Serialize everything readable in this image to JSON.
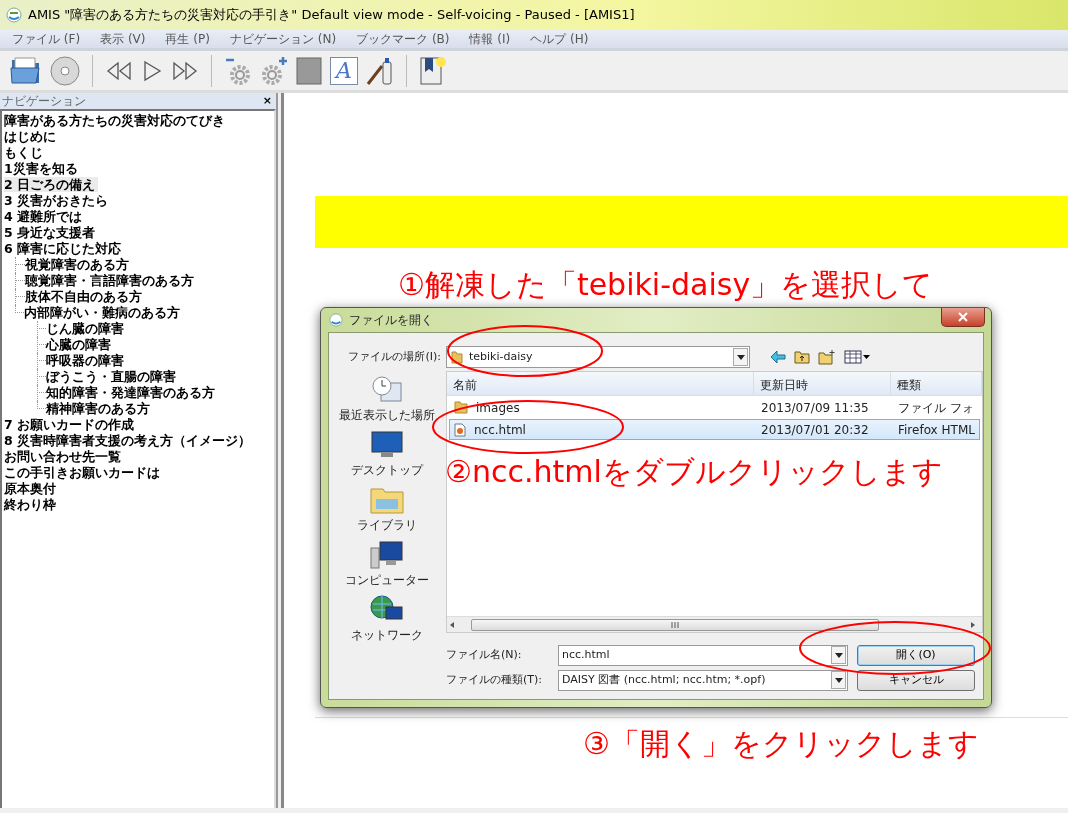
{
  "window": {
    "title": "AMIS \"障害のある方たちの災害対応の手引き\" Default view mode - Self-voicing - Paused - [AMIS1]"
  },
  "menu": [
    {
      "label": "ファイル (F)"
    },
    {
      "label": "表示 (V)"
    },
    {
      "label": "再生 (P)"
    },
    {
      "label": "ナビゲーション (N)"
    },
    {
      "label": "ブックマーク (B)"
    },
    {
      "label": "情報 (I)"
    },
    {
      "label": "ヘルプ (H)"
    }
  ],
  "toolbar": {
    "font_label": "A"
  },
  "navigation": {
    "title": "ナビゲーション",
    "close": "×",
    "items": [
      {
        "label": "障害がある方たちの災害対応のてびき",
        "selected": false
      },
      {
        "label": "はじめに",
        "selected": false
      },
      {
        "label": "もくじ",
        "selected": false
      },
      {
        "label": "1災害を知る",
        "selected": false
      },
      {
        "label": "2 日ごろの備え",
        "selected": true
      },
      {
        "label": "3 災害がおきたら",
        "selected": false
      },
      {
        "label": "4 避難所では",
        "selected": false
      },
      {
        "label": "5 身近な支援者",
        "selected": false
      },
      {
        "label": "6 障害に応じた対応",
        "selected": false,
        "children": [
          {
            "label": "視覚障害のある方",
            "selected": false
          },
          {
            "label": "聴覚障害・言語障害のある方",
            "selected": false
          },
          {
            "label": "肢体不自由のある方",
            "selected": false
          },
          {
            "label": "内部障がい・難病のある方",
            "selected": false,
            "children": [
              {
                "label": "じん臓の障害",
                "selected": false
              },
              {
                "label": "心臓の障害",
                "selected": false
              },
              {
                "label": "呼吸器の障害",
                "selected": false
              },
              {
                "label": "ぼうこう・直腸の障害",
                "selected": false
              },
              {
                "label": "知的障害・発達障害のある方",
                "selected": false
              },
              {
                "label": "精神障害のある方",
                "selected": false
              }
            ]
          }
        ]
      },
      {
        "label": "7 お願いカードの作成",
        "selected": false
      },
      {
        "label": "8 災害時障害者支援の考え方（イメージ）",
        "selected": false
      },
      {
        "label": "お問い合わせ先一覧",
        "selected": false
      },
      {
        "label": "この手引きお願いカードは",
        "selected": false
      },
      {
        "label": "原本奥付",
        "selected": false
      },
      {
        "label": "終わり枠",
        "selected": false
      }
    ]
  },
  "dialog": {
    "title": "ファイルを開く",
    "location_label": "ファイルの場所(I):",
    "location": "tebiki-daisy",
    "places": [
      {
        "label": "最近表示した場所",
        "kind": "recent"
      },
      {
        "label": "デスクトップ",
        "kind": "desktop"
      },
      {
        "label": "ライブラリ",
        "kind": "library"
      },
      {
        "label": "コンピューター",
        "kind": "computer"
      },
      {
        "label": "ネットワーク",
        "kind": "network"
      }
    ],
    "columns": [
      "名前",
      "更新日時",
      "種類"
    ],
    "files": [
      {
        "name": "images",
        "modified": "2013/07/09 11:35",
        "type": "ファイル フォ",
        "kind": "folder",
        "selected": false
      },
      {
        "name": "ncc.html",
        "modified": "2013/07/01 20:32",
        "type": "Firefox HTML",
        "kind": "html",
        "selected": true
      }
    ],
    "filename_label": "ファイル名(N):",
    "filename": "ncc.html",
    "filetype_label": "ファイルの種類(T):",
    "filetype": "DAISY 図書 (ncc.html; ncc.htm; *.opf)",
    "buttons": [
      {
        "label": "開く(O)",
        "kind": "default"
      },
      {
        "label": "キャンセル",
        "kind": "normal"
      }
    ]
  },
  "annotations": [
    {
      "text": "①解凍した「tebiki-daisy」を選択して"
    },
    {
      "text": "②ncc.htmlをダブルクリックします"
    },
    {
      "text": "③「開く」をクリックします"
    }
  ]
}
